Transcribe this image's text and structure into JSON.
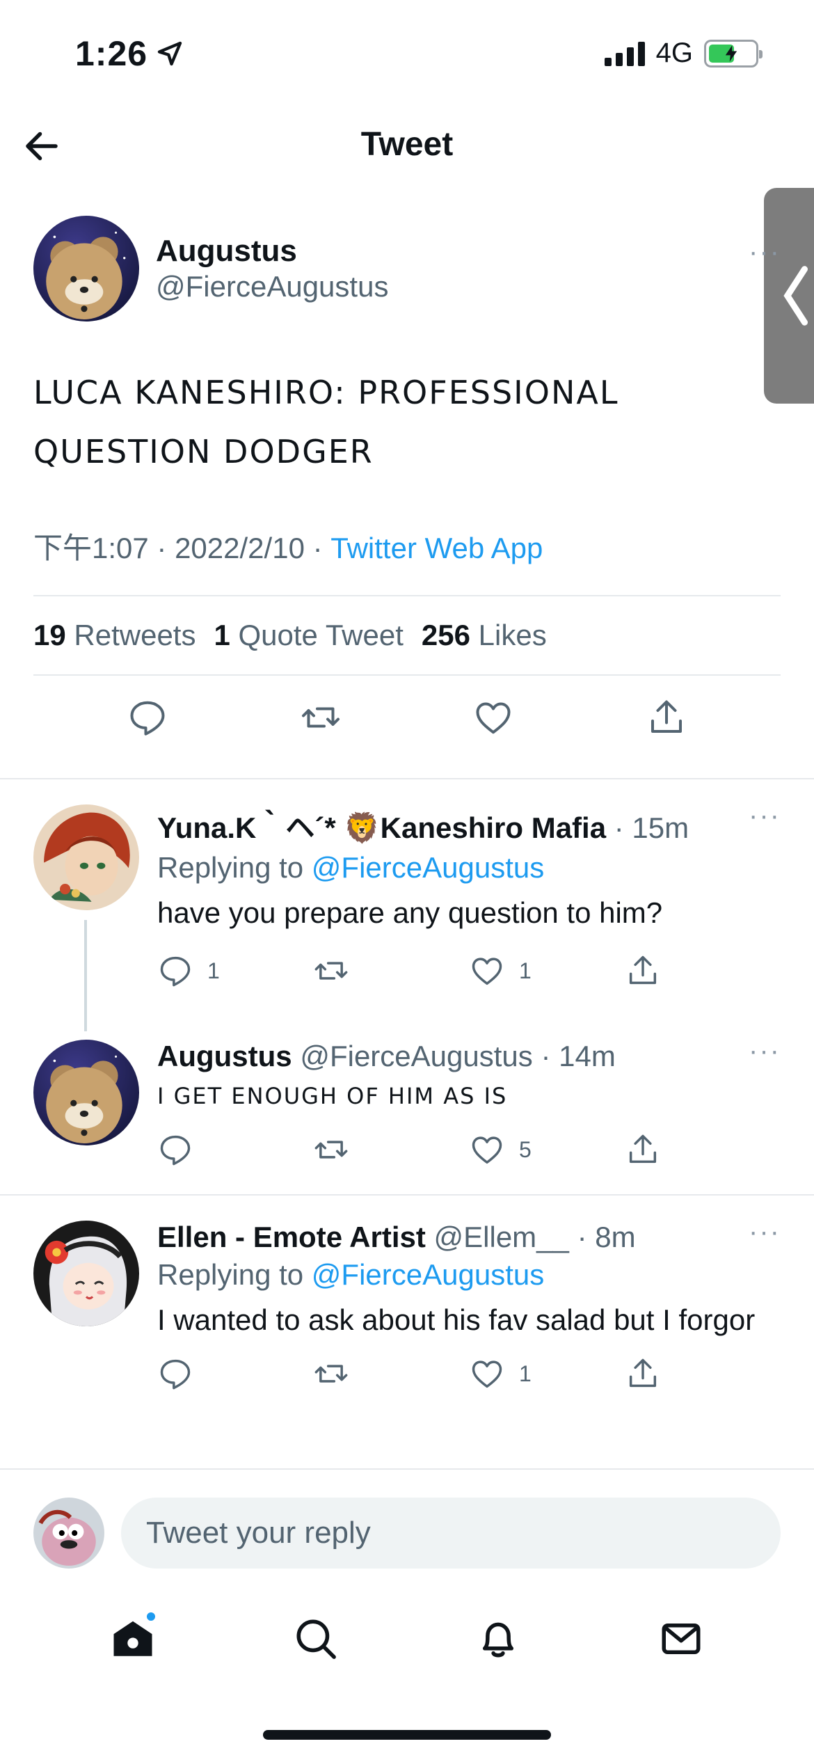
{
  "status": {
    "time": "1:26",
    "network": "4G"
  },
  "header": {
    "title": "Tweet"
  },
  "main": {
    "name": "Augustus",
    "handle": "@FierceAugustus",
    "text_line1": "LUCA KANESHIRO: PROFESSIONAL",
    "text_line2": "QUESTION DODGER",
    "time": "下午1:07",
    "date": "2022/2/10",
    "source": "Twitter Web App",
    "retweets_count": "19",
    "retweets_label": "Retweets",
    "quotes_count": "1",
    "quotes_label": "Quote Tweet",
    "likes_count": "256",
    "likes_label": "Likes"
  },
  "replies": [
    {
      "name": "Yuna.K｀ヘ´* 🦁Kaneshiro Mafia",
      "meta": "· 15m",
      "replying_label": "Replying to",
      "replying_to": "@FierceAugustus",
      "text": "have you prepare any question to him?",
      "reply_count": "1",
      "retweet_count": "",
      "like_count": "1"
    },
    {
      "name": "Augustus",
      "handle": "@FierceAugustus",
      "meta": "· 14m",
      "text": "I GET ENOUGH OF HIM AS IS",
      "reply_count": "",
      "retweet_count": "",
      "like_count": "5"
    },
    {
      "name": "Ellen - Emote Artist",
      "handle": "@Ellem__",
      "meta": "· 8m",
      "replying_label": "Replying to",
      "replying_to": "@FierceAugustus",
      "text": "I wanted to ask about his fav salad but I forgor",
      "reply_count": "",
      "retweet_count": "",
      "like_count": "1"
    }
  ],
  "composer": {
    "placeholder": "Tweet your reply"
  },
  "colors": {
    "accent": "#1d9bf0",
    "text": "#0f1419",
    "muted": "#536471"
  }
}
